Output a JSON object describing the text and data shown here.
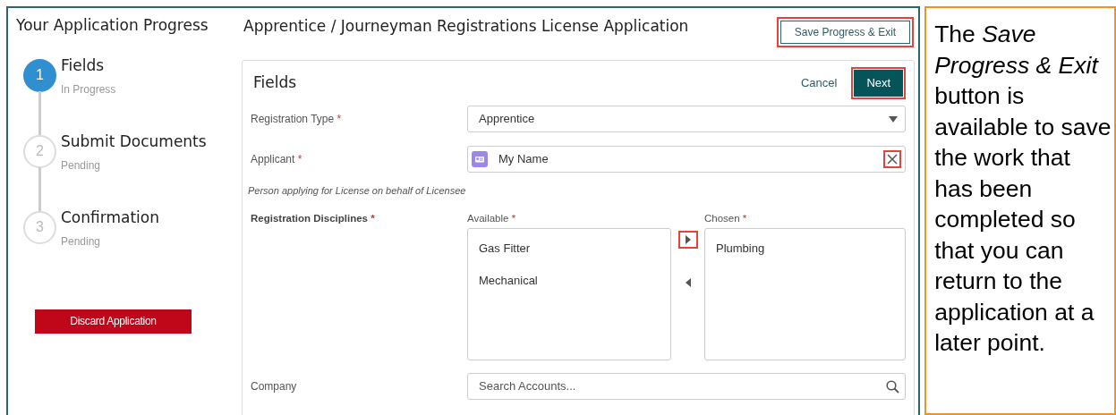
{
  "sidebar": {
    "title": "Your Application Progress",
    "steps": [
      {
        "number": "1",
        "label": "Fields",
        "status": "In Progress",
        "current": true
      },
      {
        "number": "2",
        "label": "Submit Documents",
        "status": "Pending",
        "current": false
      },
      {
        "number": "3",
        "label": "Confirmation",
        "status": "Pending",
        "current": false
      }
    ],
    "discard_button": "Discard Application"
  },
  "header": {
    "title": "Apprentice / Journeyman Registrations License Application",
    "save_button": {
      "label": "Save Progress & Exit",
      "highlighted": true
    }
  },
  "form": {
    "title": "Fields",
    "cancel_button": {
      "label": "Cancel",
      "highlighted": false
    },
    "next_button": {
      "label": "Next",
      "highlighted": true
    },
    "registration_type": {
      "label": "Registration Type",
      "required_mark": "*",
      "value": "Apprentice"
    },
    "applicant": {
      "label": "Applicant",
      "required_mark": "*",
      "value": "My Name",
      "clear_highlighted": true,
      "help": "Person applying for License on behalf of Licensee"
    },
    "disciplines": {
      "label": "Registration Disciplines",
      "required_mark": "*",
      "available": {
        "label": "Available",
        "required_mark": "*",
        "items": [
          "Gas Fitter",
          "Mechanical"
        ]
      },
      "chosen": {
        "label": "Chosen",
        "required_mark": "*",
        "items": [
          "Plumbing"
        ]
      },
      "move_right_highlighted": true,
      "move_left_highlighted": false
    },
    "company": {
      "label": "Company",
      "placeholder": "Search Accounts..."
    }
  },
  "callout": {
    "text": "The *Save Progress & Exit* button is available to save the work that has been completed so that you can return to the application at a later point."
  }
}
